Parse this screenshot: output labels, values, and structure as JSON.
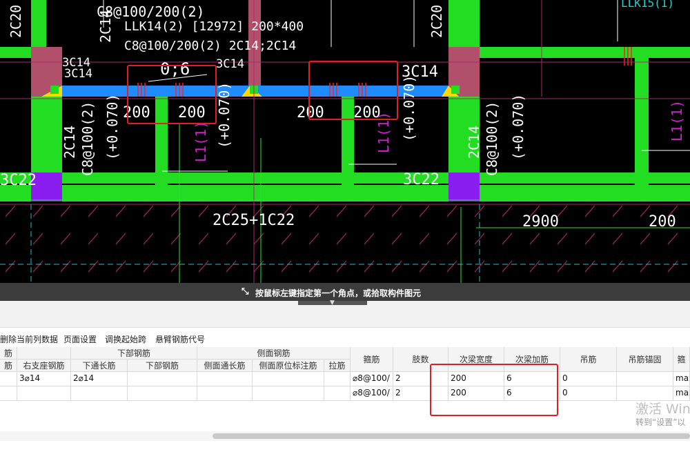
{
  "cad": {
    "labels": {
      "stirrup_top": "C8@100/200(2)",
      "beam_name": "LLK14(2) [12972] 200*400",
      "beam_stirrup": "C8@100/200(2) 2C14;2C14",
      "left_col_top": "2C20",
      "mid_col_top": "2C14",
      "right_col_top": "2C20",
      "l3c14_a": "3C14",
      "l3c14_b": "3C14",
      "l3c14_c": "3C14",
      "l3c14_d": "3C14",
      "dim_06": "0;6",
      "dim_200_a": "200",
      "dim_200_b": "200",
      "dim_200_c": "200",
      "dim_200_d": "200",
      "vert_2c14_a": "2C14",
      "vert_c8_a": "C8@100(2)",
      "vert_elev_a": "(+0.070)",
      "vert_l1_a": "L1(1)",
      "vert_elev_b": "(+0.070)",
      "vert_l1_b": "L1(1)",
      "vert_elev_c": "(+0.070)",
      "vert_2c14_b": "2C14",
      "vert_c8_b": "C8@100(2)",
      "vert_elev_d": "(+0.070)",
      "vert_l1_c": "L1(1)",
      "left_3c22": "3C22",
      "mid_3c22": "3C22",
      "bottom_2c25": "2C25+1C22",
      "dim_2900": "2900",
      "dim_200_e": "200",
      "top_right_label": "LLK15(1)"
    }
  },
  "status": {
    "message": "按鼠标左键指定第一个角点，或拾取构件图元"
  },
  "toolbar": {
    "items": [
      "删除当前列数据",
      "页面设置",
      "调换起始跨",
      "悬臂钢筋代号"
    ]
  },
  "grid": {
    "group_headers": {
      "partial_left": "筋",
      "lower_bars": "下部钢筋",
      "side_bars": "侧面钢筋"
    },
    "columns": {
      "partial_col": "筋",
      "right_support": "右支座钢筋",
      "lower_through": "下通长筋",
      "lower_bar": "下部钢筋",
      "side_through": "侧面通长筋",
      "side_in_situ": "侧面原位标注筋",
      "tie_bar": "拉筋",
      "stirrup": "箍筋",
      "legs": "肢数",
      "secondary_width": "次梁宽度",
      "secondary_add": "次梁加筋",
      "hanger": "吊筋",
      "hanger_anchor": "吊筋锚固",
      "partial_last": "箍"
    },
    "rows": [
      {
        "right_support": "3⌀14",
        "lower_through": "2⌀14",
        "stirrup": "⌀8@100/",
        "legs": "2",
        "secondary_width": "200",
        "secondary_add": "6",
        "hanger": "0",
        "partial_last": "max"
      },
      {
        "right_support": "",
        "lower_through": "",
        "stirrup": "⌀8@100/",
        "legs": "2",
        "secondary_width": "200",
        "secondary_add": "6",
        "hanger": "0",
        "partial_last": "max"
      }
    ]
  },
  "watermark": {
    "line1": "激活 Win",
    "line2": "转到“设置”以"
  },
  "colors": {
    "cad_bg": "#000000",
    "beam_green": "#22dd22",
    "beam_blue": "#1e8cff",
    "column_pink": "#b0506a",
    "column_purple": "#8a1ef0",
    "highlight_red": "#e02020"
  }
}
